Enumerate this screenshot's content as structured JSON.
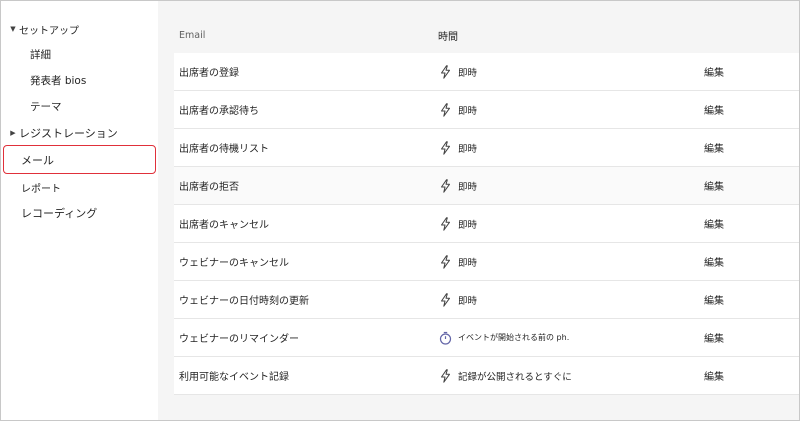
{
  "sidebar": {
    "setup": {
      "label": "セットアップ",
      "expanded": true
    },
    "setup_children": [
      {
        "label": "詳細"
      },
      {
        "label": "発表者 bios"
      },
      {
        "label": "テーマ"
      }
    ],
    "registration": {
      "label": "レジストレーション",
      "expanded": false
    },
    "mail": {
      "label": "メール",
      "selected": true
    },
    "report": {
      "label": "レポート"
    },
    "recording": {
      "label": "レコーディング"
    }
  },
  "table": {
    "col_email": "Email",
    "col_time": "時間",
    "rows": [
      {
        "name": "出席者の登録",
        "icon": "lightning-icon",
        "time": "即時",
        "edit": "編集"
      },
      {
        "name": "出席者の承認待ち",
        "icon": "lightning-icon",
        "time": "即時",
        "edit": "編集"
      },
      {
        "name": "出席者の待機リスト",
        "icon": "lightning-icon",
        "time": "即時",
        "edit": "編集"
      },
      {
        "name": "出席者の拒否",
        "icon": "lightning-icon",
        "time": "即時",
        "edit": "編集"
      },
      {
        "name": "出席者のキャンセル",
        "icon": "lightning-icon",
        "time": "即時",
        "edit": "編集"
      },
      {
        "name": "ウェビナーのキャンセル",
        "icon": "lightning-icon",
        "time": "即時",
        "edit": "編集"
      },
      {
        "name": "ウェビナーの日付時刻の更新",
        "icon": "lightning-icon",
        "time": "即時",
        "edit": "編集"
      },
      {
        "name": "ウェビナーのリマインダー",
        "icon": "stopwatch-icon",
        "time": "イベントが開始される前の ph.",
        "edit": "編集"
      },
      {
        "name": "利用可能なイベント記録",
        "icon": "lightning-icon",
        "time": "記録が公開されるとすぐに",
        "edit": "編集"
      }
    ]
  },
  "colors": {
    "selected_outline": "#e0303a",
    "stopwatch_accent": "#6264a7",
    "main_bg": "#f5f5f5"
  }
}
